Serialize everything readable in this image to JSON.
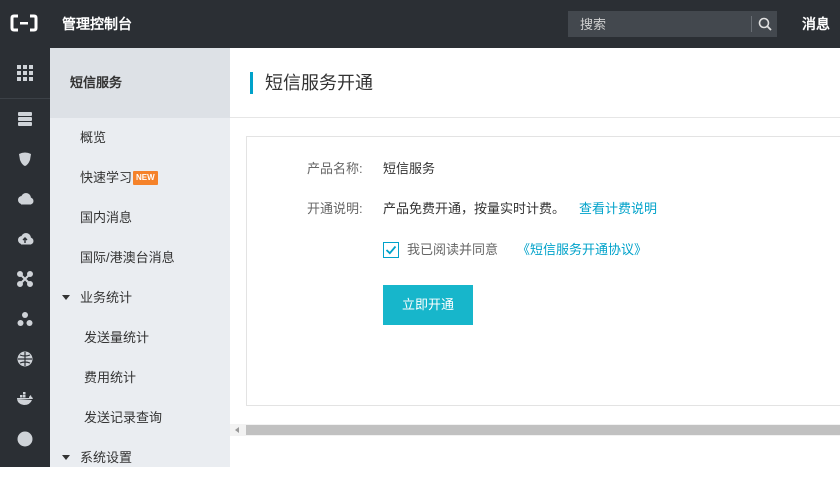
{
  "header": {
    "brand": "管理控制台",
    "search_placeholder": "搜索",
    "messages": "消息"
  },
  "rail": {
    "icons": [
      "grid-icon",
      "database-icon",
      "shield-icon",
      "cloud-icon",
      "cloud-upload-icon",
      "network-icon",
      "cluster-icon",
      "globe-icon",
      "docker-icon",
      "circle-icon"
    ]
  },
  "sidebar": {
    "title": "短信服务",
    "items": [
      {
        "label": "概览"
      },
      {
        "label": "快速学习",
        "badge": "NEW"
      },
      {
        "label": "国内消息"
      },
      {
        "label": "国际/港澳台消息"
      }
    ],
    "group1": {
      "label": "业务统计",
      "children": [
        {
          "label": "发送量统计"
        },
        {
          "label": "费用统计"
        },
        {
          "label": "发送记录查询"
        }
      ]
    },
    "group2": {
      "label": "系统设置"
    }
  },
  "main": {
    "title": "短信服务开通",
    "product_label": "产品名称:",
    "product_value": "短信服务",
    "desc_label": "开通说明:",
    "desc_value": "产品免费开通，按量实时计费。",
    "desc_link": "查看计费说明",
    "agree_text": "我已阅读并同意",
    "agree_link": "《短信服务开通协议》",
    "agree_checked": true,
    "submit": "立即开通"
  },
  "colors": {
    "topbar": "#2b2f34",
    "accent": "#00a2ca",
    "button": "#17b6cb",
    "badge": "#f5822a"
  }
}
